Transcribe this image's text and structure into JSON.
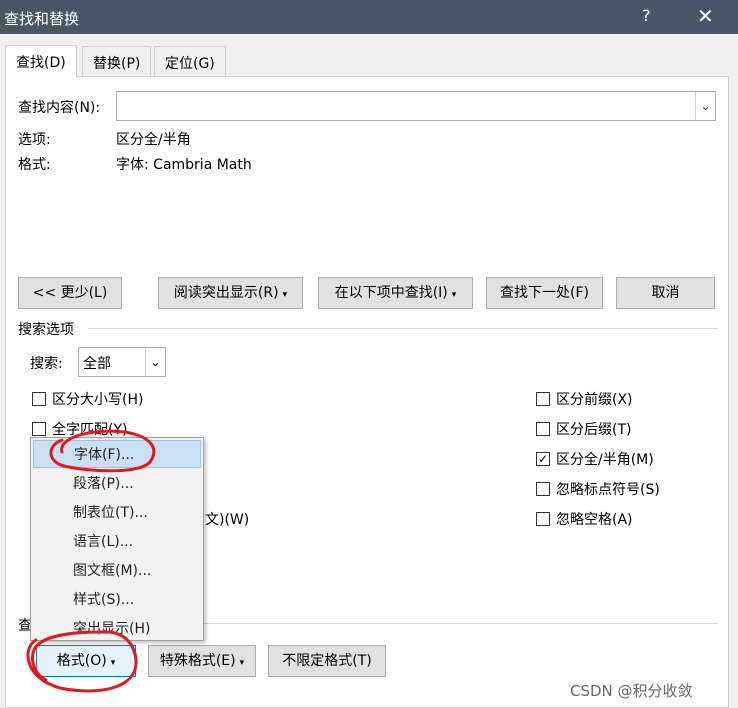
{
  "window": {
    "title": "查找和替换",
    "help_glyph": "?",
    "close_glyph": "✕"
  },
  "tabs": [
    {
      "label": "查找(D)"
    },
    {
      "label": "替换(P)"
    },
    {
      "label": "定位(G)"
    }
  ],
  "find": {
    "label": "查找内容(N):",
    "value": "",
    "options_label": "选项:",
    "options_value": "区分全/半角",
    "format_label": "格式:",
    "format_value": "字体: Cambria Math"
  },
  "buttons": {
    "less": "<< 更少(L)",
    "reading_highlight": "阅读突出显示(R)",
    "find_in": "在以下项中查找(I)",
    "find_next": "查找下一处(F)",
    "cancel": "取消",
    "format": "格式(O)",
    "special": "特殊格式(E)",
    "no_format": "不限定格式(T)",
    "caret": "▾"
  },
  "search_options": {
    "heading": "搜索选项",
    "search_label": "搜索:",
    "search_value": "全部",
    "left": [
      {
        "label": "区分大小写(H)",
        "checked": false
      },
      {
        "label": "全字匹配(Y)",
        "checked": false
      }
    ],
    "partial_hidden_label": "文)(W)",
    "right": [
      {
        "label": "区分前缀(X)",
        "checked": false
      },
      {
        "label": "区分后缀(T)",
        "checked": false
      },
      {
        "label": "区分全/半角(M)",
        "checked": true
      },
      {
        "label": "忽略标点符号(S)",
        "checked": false
      },
      {
        "label": "忽略空格(A)",
        "checked": false
      }
    ],
    "check_glyph": "✓"
  },
  "section_partial": "查",
  "format_menu": [
    {
      "label": "字体(F)..."
    },
    {
      "label": "段落(P)..."
    },
    {
      "label": "制表位(T)..."
    },
    {
      "label": "语言(L)..."
    },
    {
      "label": "图文框(M)..."
    },
    {
      "label": "样式(S)..."
    },
    {
      "label": "突出显示(H)"
    }
  ],
  "annotation_color": "#e0191e",
  "watermark": "CSDN @积分收敛"
}
